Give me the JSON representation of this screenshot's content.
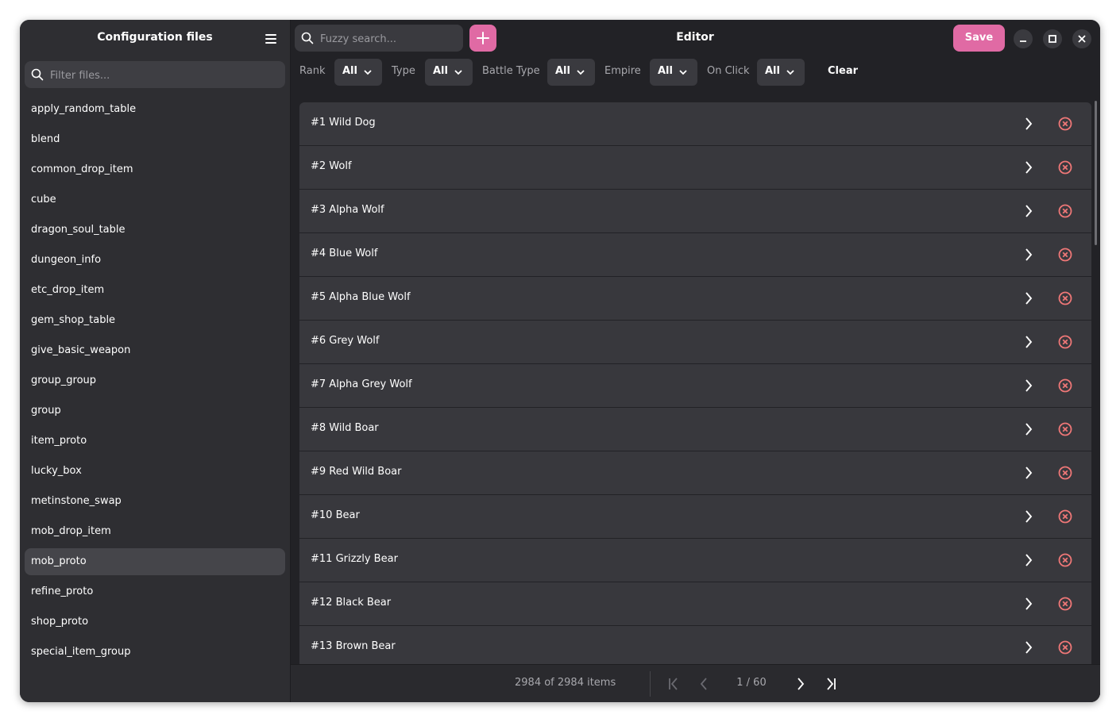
{
  "sidebar": {
    "title": "Configuration files",
    "filter_placeholder": "Filter files...",
    "files": [
      {
        "label": "apply_random_table"
      },
      {
        "label": "blend"
      },
      {
        "label": "common_drop_item"
      },
      {
        "label": "cube"
      },
      {
        "label": "dragon_soul_table"
      },
      {
        "label": "dungeon_info"
      },
      {
        "label": "etc_drop_item"
      },
      {
        "label": "gem_shop_table"
      },
      {
        "label": "give_basic_weapon"
      },
      {
        "label": "group_group"
      },
      {
        "label": "group"
      },
      {
        "label": "item_proto"
      },
      {
        "label": "lucky_box"
      },
      {
        "label": "metinstone_swap"
      },
      {
        "label": "mob_drop_item"
      },
      {
        "label": "mob_proto"
      },
      {
        "label": "refine_proto"
      },
      {
        "label": "shop_proto"
      },
      {
        "label": "special_item_group"
      }
    ],
    "active_file": "mob_proto"
  },
  "header": {
    "search_placeholder": "Fuzzy search...",
    "title": "Editor",
    "save_label": "Save"
  },
  "filters": {
    "rank": {
      "label": "Rank",
      "value": "All"
    },
    "type": {
      "label": "Type",
      "value": "All"
    },
    "battle_type": {
      "label": "Battle Type",
      "value": "All"
    },
    "empire": {
      "label": "Empire",
      "value": "All"
    },
    "on_click": {
      "label": "On Click",
      "value": "All"
    },
    "clear_label": "Clear"
  },
  "items": [
    {
      "label": "#1 Wild Dog"
    },
    {
      "label": "#2 Wolf"
    },
    {
      "label": "#3 Alpha Wolf"
    },
    {
      "label": "#4 Blue Wolf"
    },
    {
      "label": "#5 Alpha Blue Wolf"
    },
    {
      "label": "#6 Grey Wolf"
    },
    {
      "label": "#7 Alpha Grey Wolf"
    },
    {
      "label": "#8 Wild Boar"
    },
    {
      "label": "#9 Red Wild Boar"
    },
    {
      "label": "#10 Bear"
    },
    {
      "label": "#11 Grizzly Bear"
    },
    {
      "label": "#12 Black Bear"
    },
    {
      "label": "#13 Brown Bear"
    }
  ],
  "footer": {
    "count_text": "2984 of 2984 items",
    "page_text": "1 / 60"
  },
  "colors": {
    "accent": "#e06aa4",
    "delete": "#ee7777",
    "background": "#222226",
    "sidebar": "#2e2e32",
    "row": "#38383d"
  },
  "icons": {
    "menu": "hamburger-icon",
    "search": "search-icon",
    "add": "plus-icon",
    "dropdown": "chevron-down-icon",
    "open_row": "chevron-right-icon",
    "delete_row": "close-circle-icon",
    "minimize": "minimize-icon",
    "maximize": "maximize-icon",
    "close": "close-icon",
    "first_page": "first-page-icon",
    "prev_page": "prev-page-icon",
    "next_page": "next-page-icon",
    "last_page": "last-page-icon"
  }
}
